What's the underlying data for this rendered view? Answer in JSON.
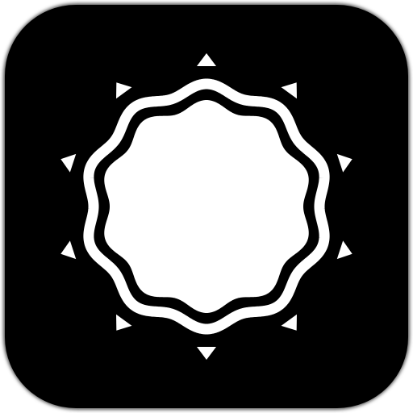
{
  "icon": {
    "name": "sun-badge-app-icon",
    "colors": {
      "background": "#000000",
      "foreground": "#ffffff"
    },
    "ray_count": 10,
    "outline_wave_count": 10
  }
}
